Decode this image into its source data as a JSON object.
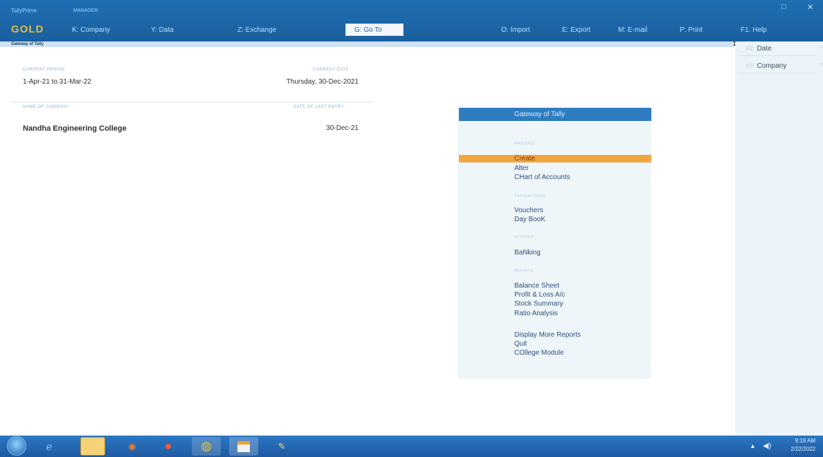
{
  "header": {
    "product_line": "TallyPrime",
    "serial_line": "MANAGER",
    "edition": "GOLD",
    "menu": {
      "company": "K: Company",
      "data": "Y: Data",
      "exchange": "Z: Exchange",
      "goto": "G: Go To",
      "import": "O: Import",
      "export": "E: Export",
      "email": "M: E-mail",
      "print": "P: Print",
      "help": "F1: Help"
    }
  },
  "screen_title": "Gateway of Tally",
  "info": {
    "current_period_label": "CURRENT PERIOD",
    "current_period": "1-Apr-21 to 31-Mar-22",
    "current_date_label": "CURRENT DATE",
    "current_date": "Thursday, 30-Dec-2021",
    "company_name_label": "NAME OF COMPANY",
    "company_name": "Nandha Engineering College",
    "last_entry_label": "DATE OF LAST ENTRY",
    "last_entry": "30-Dec-21"
  },
  "gateway": {
    "title": "Gateway of Tally",
    "sections": {
      "masters": "MASTERS",
      "transactions": "TRANSACTIONS",
      "utilities": "UTILITIES",
      "reports": "REPORTS"
    },
    "items": {
      "create": "Create",
      "alter": "Alter",
      "chart_of_accounts": "CHart of Accounts",
      "vouchers": "Vouchers",
      "day_book": "Day BooK",
      "banking": "BaNking",
      "balance_sheet": "Balance Sheet",
      "profit_loss": "Profit & Loss A/c",
      "stock_summary": "Stock Summary",
      "ratio_analysis": "Ratio Analysis",
      "display_more": "Display More Reports",
      "quit": "Quit",
      "college_module": "COllege Module"
    },
    "highlight_color": "#f2a640"
  },
  "sidebar": {
    "date_key": "F2:",
    "date_label": "Date",
    "company_key": "F3:",
    "company_label": "Company"
  },
  "taskbar": {
    "icons": [
      "start-orb",
      "internet-explorer",
      "file-explorer",
      "media-player",
      "firefox",
      "chrome",
      "app-window",
      "paint"
    ],
    "time": "9:19 AM",
    "date": "2/22/2022"
  }
}
